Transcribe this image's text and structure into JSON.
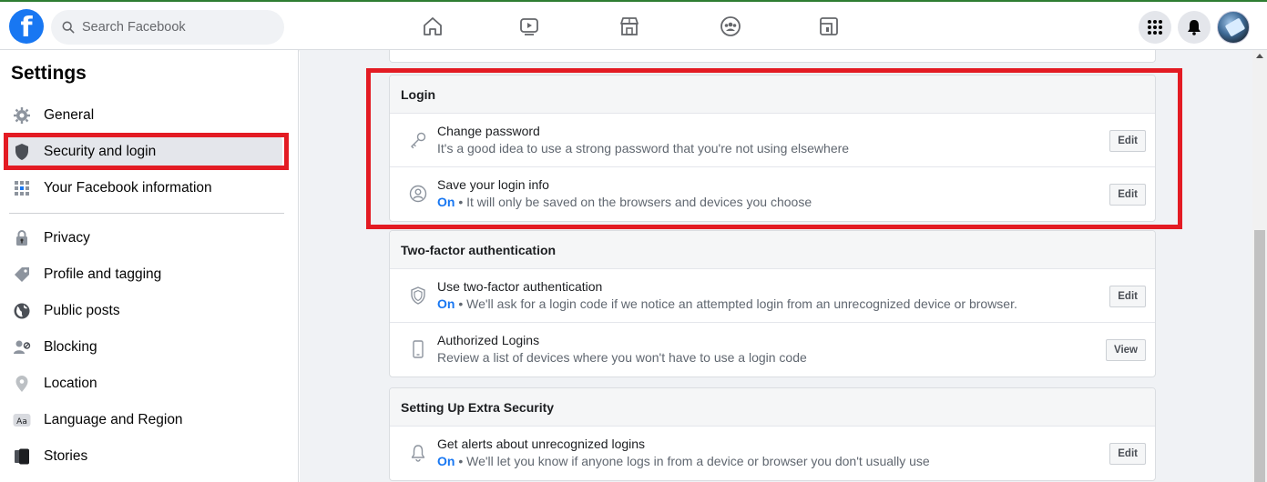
{
  "topbar": {
    "logo": "f",
    "search_placeholder": "Search Facebook",
    "nav": [
      {
        "name": "home-icon"
      },
      {
        "name": "watch-icon"
      },
      {
        "name": "marketplace-icon"
      },
      {
        "name": "groups-icon"
      },
      {
        "name": "gaming-icon"
      }
    ],
    "right_buttons": [
      "menu-grid-icon",
      "notifications-bell-icon"
    ]
  },
  "sidebar": {
    "title": "Settings",
    "items": [
      {
        "label": "General",
        "icon": "gear-icon"
      },
      {
        "label": "Security and login",
        "icon": "shield-icon",
        "active": true
      },
      {
        "label": "Your Facebook information",
        "icon": "facebook-info-icon"
      },
      {
        "label": "Privacy",
        "icon": "lock-icon"
      },
      {
        "label": "Profile and tagging",
        "icon": "tag-icon"
      },
      {
        "label": "Public posts",
        "icon": "globe-icon"
      },
      {
        "label": "Blocking",
        "icon": "block-user-icon"
      },
      {
        "label": "Location",
        "icon": "location-pin-icon"
      },
      {
        "label": "Language and Region",
        "icon": "language-icon"
      },
      {
        "label": "Stories",
        "icon": "stories-icon"
      }
    ]
  },
  "sections": {
    "login": {
      "header": "Login",
      "rows": [
        {
          "title": "Change password",
          "on": "",
          "desc": "It's a good idea to use a strong password that you're not using elsewhere",
          "button": "Edit",
          "icon": "key-icon"
        },
        {
          "title": "Save your login info",
          "on": "On",
          "desc": " • It will only be saved on the browsers and devices you choose",
          "button": "Edit",
          "icon": "user-circle-icon"
        }
      ]
    },
    "two_factor": {
      "header": "Two-factor authentication",
      "rows": [
        {
          "title": "Use two-factor authentication",
          "on": "On",
          "desc": " • We'll ask for a login code if we notice an attempted login from an unrecognized device or browser.",
          "button": "Edit",
          "icon": "shield-outline-icon"
        },
        {
          "title": "Authorized Logins",
          "on": "",
          "desc": "Review a list of devices where you won't have to use a login code",
          "button": "View",
          "icon": "phone-icon"
        }
      ]
    },
    "extra_security": {
      "header": "Setting Up Extra Security",
      "rows": [
        {
          "title": "Get alerts about unrecognized logins",
          "on": "On",
          "desc": " • We'll let you know if anyone logs in from a device or browser you don't usually use",
          "button": "Edit",
          "icon": "bell-icon"
        }
      ]
    }
  },
  "colors": {
    "brand": "#1877f2",
    "highlight": "#e31b23",
    "on_text": "#1877f2"
  }
}
